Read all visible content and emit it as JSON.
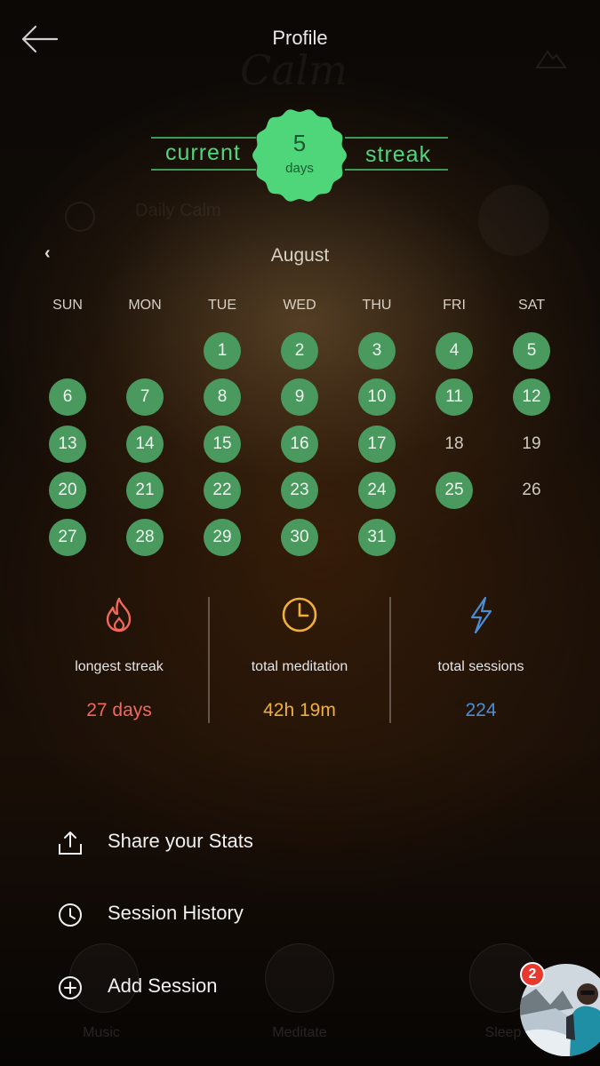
{
  "header": {
    "title": "Profile",
    "back_icon": "arrow-left-icon",
    "ghost_logo": "Calm"
  },
  "streak": {
    "left_word": "current",
    "right_word": "streak",
    "count": "5",
    "unit": "days",
    "color": "#4fd67a"
  },
  "background_ghost": {
    "daily_calm": "Daily Calm"
  },
  "calendar": {
    "month": "August",
    "prev_icon": "chevron-left-icon",
    "weekdays": [
      "SUN",
      "MON",
      "TUE",
      "WED",
      "THU",
      "FRI",
      "SAT"
    ],
    "days": [
      {
        "d": "1",
        "done": true
      },
      {
        "d": "2",
        "done": true
      },
      {
        "d": "3",
        "done": true
      },
      {
        "d": "4",
        "done": true
      },
      {
        "d": "5",
        "done": true
      },
      {
        "d": "6",
        "done": true
      },
      {
        "d": "7",
        "done": true
      },
      {
        "d": "8",
        "done": true
      },
      {
        "d": "9",
        "done": true
      },
      {
        "d": "10",
        "done": true
      },
      {
        "d": "11",
        "done": true
      },
      {
        "d": "12",
        "done": true
      },
      {
        "d": "13",
        "done": true
      },
      {
        "d": "14",
        "done": true
      },
      {
        "d": "15",
        "done": true
      },
      {
        "d": "16",
        "done": true
      },
      {
        "d": "17",
        "done": true
      },
      {
        "d": "18",
        "done": false
      },
      {
        "d": "19",
        "done": false
      },
      {
        "d": "20",
        "done": true
      },
      {
        "d": "21",
        "done": true
      },
      {
        "d": "22",
        "done": true
      },
      {
        "d": "23",
        "done": true
      },
      {
        "d": "24",
        "done": true
      },
      {
        "d": "25",
        "done": true
      },
      {
        "d": "26",
        "done": false
      },
      {
        "d": "27",
        "done": true
      },
      {
        "d": "28",
        "done": true
      },
      {
        "d": "29",
        "done": true
      },
      {
        "d": "30",
        "done": true
      },
      {
        "d": "31",
        "done": true
      }
    ],
    "done_color": "#4a9a5f"
  },
  "stats": [
    {
      "label": "longest streak",
      "value": "27 days",
      "icon": "flame-icon",
      "color": "#f06a5c"
    },
    {
      "label": "total meditation",
      "value": "42h 19m",
      "icon": "clock-icon",
      "color": "#f0b13a"
    },
    {
      "label": "total sessions",
      "value": "224",
      "icon": "lightning-icon",
      "color": "#4a8fd6"
    }
  ],
  "menu": [
    {
      "label": "Share your Stats",
      "icon": "share-icon"
    },
    {
      "label": "Session History",
      "icon": "clock-icon"
    },
    {
      "label": "Add Session",
      "icon": "plus-circle-icon"
    }
  ],
  "ghost_nav": [
    {
      "label": "Music"
    },
    {
      "label": "Meditate"
    },
    {
      "label": "Sleep"
    }
  ],
  "chat_head": {
    "badge_count": "2"
  }
}
